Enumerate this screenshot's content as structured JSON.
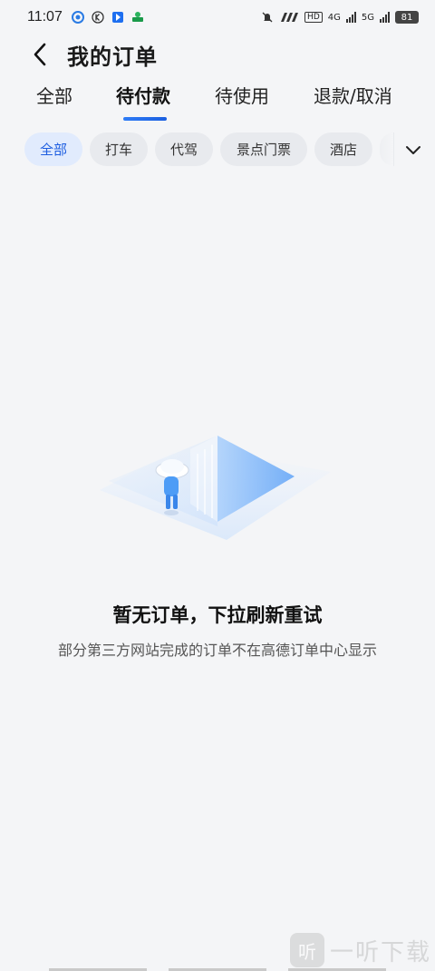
{
  "status_bar": {
    "time": "11:07",
    "network_1": "4G",
    "network_2": "5G",
    "hd_label": "HD",
    "battery": "81"
  },
  "header": {
    "title": "我的订单"
  },
  "tabs": [
    {
      "label": "全部",
      "active": false
    },
    {
      "label": "待付款",
      "active": true
    },
    {
      "label": "待使用",
      "active": false
    },
    {
      "label": "退款/取消",
      "active": false
    }
  ],
  "chips": [
    {
      "label": "全部",
      "active": true
    },
    {
      "label": "打车",
      "active": false
    },
    {
      "label": "代驾",
      "active": false
    },
    {
      "label": "景点门票",
      "active": false
    },
    {
      "label": "酒店",
      "active": false
    }
  ],
  "empty_state": {
    "title": "暂无订单，下拉刷新重试",
    "description": "部分第三方网站完成的订单不在高德订单中心显示"
  },
  "watermark": {
    "icon_text": "听",
    "text": "一听下载"
  },
  "colors": {
    "accent": "#1e5ee0",
    "background": "#f4f5f7",
    "chip_bg": "#e8eaee",
    "chip_active_bg": "#e1ebfd"
  }
}
